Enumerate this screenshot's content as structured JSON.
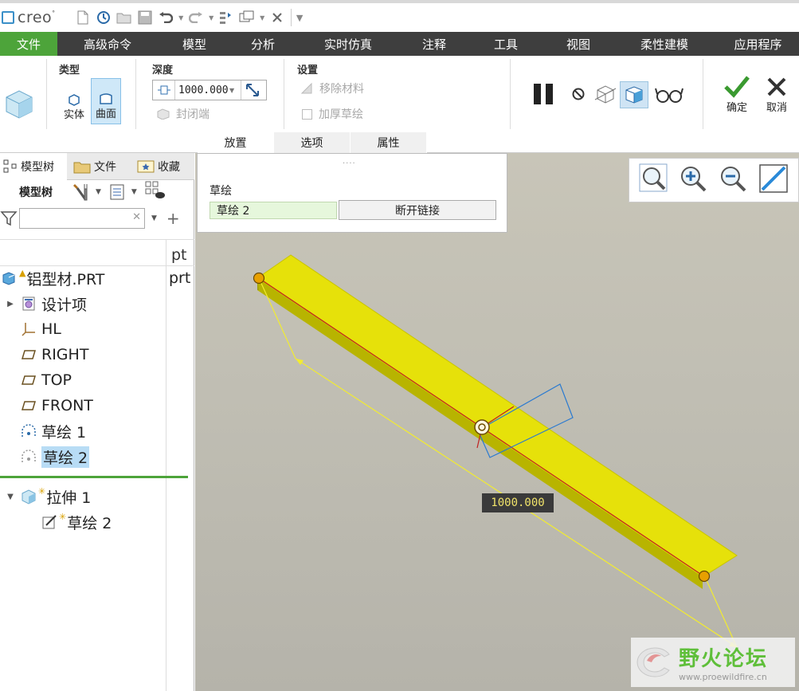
{
  "app": {
    "logo_text": "creo"
  },
  "menu": {
    "items": [
      {
        "label": "文件",
        "active": true
      },
      {
        "label": "高级命令"
      },
      {
        "label": "模型"
      },
      {
        "label": "分析"
      },
      {
        "label": "实时仿真"
      },
      {
        "label": "注释"
      },
      {
        "label": "工具"
      },
      {
        "label": "视图"
      },
      {
        "label": "柔性建模"
      },
      {
        "label": "应用程序"
      }
    ]
  },
  "ribbon": {
    "type_group": {
      "title": "类型",
      "solid": "实体",
      "surface": "曲面"
    },
    "depth_group": {
      "title": "深度",
      "value": "1000.000",
      "cap_ends": "封闭端"
    },
    "settings_group": {
      "title": "设置",
      "remove_material": "移除材料",
      "thicken_sketch": "加厚草绘"
    },
    "confirm": "确定",
    "cancel": "取消",
    "tabs": [
      {
        "label": "放置",
        "active": true
      },
      {
        "label": "选项"
      },
      {
        "label": "属性"
      }
    ]
  },
  "left_panel": {
    "tabs": [
      {
        "label": "模型树",
        "active": true
      },
      {
        "label": "文件"
      },
      {
        "label": "收藏"
      }
    ],
    "toolbar_title": "模型树",
    "filter_placeholder": "",
    "column_header": "pt",
    "tree": [
      {
        "label": "铝型材.PRT",
        "col": "prt"
      },
      {
        "label": "设计项"
      },
      {
        "label": "HL"
      },
      {
        "label": "RIGHT"
      },
      {
        "label": "TOP"
      },
      {
        "label": "FRONT"
      },
      {
        "label": "草绘 1"
      },
      {
        "label": "草绘 2",
        "selected": true
      }
    ],
    "feature_tree": [
      {
        "label": "拉伸 1"
      },
      {
        "label": "草绘 2"
      }
    ]
  },
  "placement_panel": {
    "sketch_label": "草绘",
    "sketch_value": "草绘 2",
    "unlink_button": "断开链接"
  },
  "viewport": {
    "dimension": "1000.000",
    "model_color": "#e3e000"
  },
  "watermark": {
    "title": "野火论坛",
    "url": "www.proewildfire.cn"
  }
}
